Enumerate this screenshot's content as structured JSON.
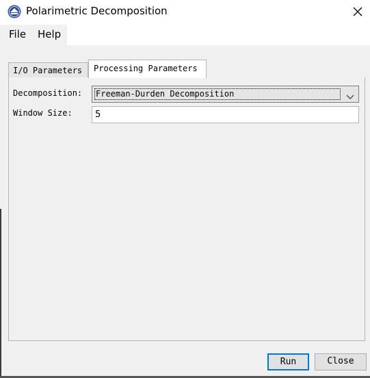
{
  "window": {
    "title": "Polarimetric Decomposition"
  },
  "menu": {
    "file": "File",
    "help": "Help"
  },
  "tabs": [
    {
      "label": "I/O Parameters",
      "selected": false
    },
    {
      "label": "Processing Parameters",
      "selected": true
    }
  ],
  "form": {
    "decomposition_label": "Decomposition:",
    "decomposition_value": "Freeman-Durden Decomposition",
    "window_size_label": "Window Size:",
    "window_size_value": "5"
  },
  "buttons": {
    "run": "Run",
    "close": "Close"
  },
  "colors": {
    "focus_accent": "#0078d7",
    "window_bg": "#f0f0f0"
  }
}
